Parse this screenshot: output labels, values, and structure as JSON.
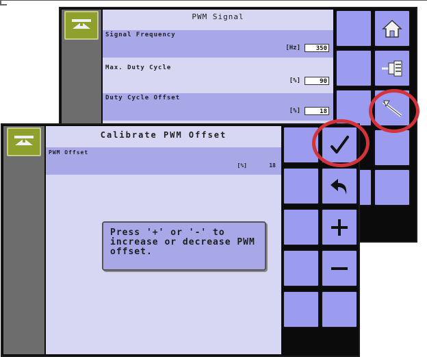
{
  "back_screen": {
    "title": "PWM Signal",
    "rows": [
      {
        "label": "Signal Frequency",
        "unit": "[Hz]",
        "value": "350"
      },
      {
        "label": "Max. Duty Cycle",
        "unit": "[%]",
        "value": "90"
      },
      {
        "label": "Duty Cycle Offset",
        "unit": "[%]",
        "value": "18"
      }
    ],
    "icons": [
      "home-icon",
      "machine-settings-icon",
      "calibrate-tool-icon"
    ]
  },
  "front_screen": {
    "title": "Calibrate PWM Offset",
    "row": {
      "label": "PWM Offset",
      "unit": "[%]",
      "value": "18"
    },
    "message": "Press '+' or '-' to\nincrease or decrease PWM\noffset.",
    "icons": [
      "accept-check-icon",
      "back-arrow-icon",
      "plus-icon",
      "minus-icon"
    ]
  },
  "highlight_color": "#d3343b",
  "button_color": "#9b9bf0",
  "panel_color": "#d7d7f3"
}
